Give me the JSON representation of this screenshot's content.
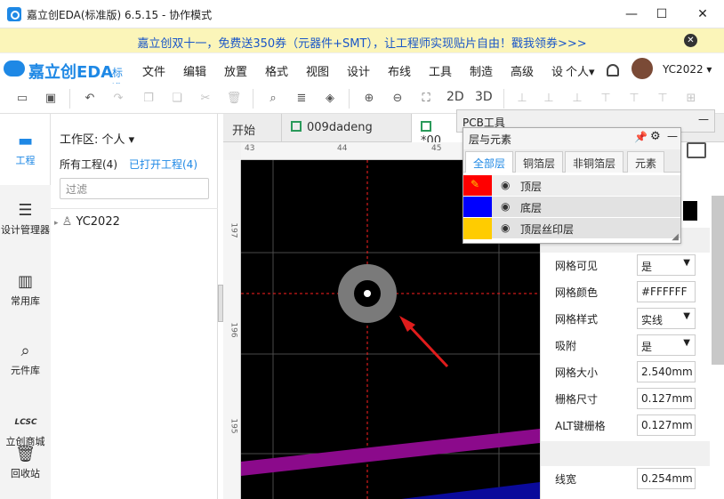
{
  "window": {
    "title": "嘉立创EDA(标准版) 6.5.15 - 协作模式",
    "min_label": "—",
    "max_label": "☐",
    "close_label": "✕"
  },
  "banner": {
    "text": "嘉立创双十一，免费送350券（元器件+SMT），让工程师实现贴片自由！戳我领券>>>",
    "close_label": "✕"
  },
  "logo": {
    "name": "嘉立创EDA",
    "edition": "标准"
  },
  "menu": [
    "文件",
    "编辑",
    "放置",
    "格式",
    "视图",
    "设计",
    "布线",
    "工具",
    "制造",
    "高级",
    "设"
  ],
  "account": {
    "workspace": "个人",
    "user": "YC2022"
  },
  "toolbar": {
    "label_2d": "2D",
    "label_3d": "3D"
  },
  "leftbar": [
    {
      "label": "工程",
      "icon": "folder-icon"
    },
    {
      "label": "设计管理器",
      "icon": "design-manager-icon"
    },
    {
      "label": "常用库",
      "icon": "chip-icon"
    },
    {
      "label": "元件库",
      "icon": "component-search-icon"
    },
    {
      "label": "立创商城",
      "icon": "lcsc-icon"
    },
    {
      "label": "回收站",
      "icon": "trash-icon"
    }
  ],
  "project_panel": {
    "workspace_label": "工作区: 个人 ▾",
    "tab_all": "所有工程(4)",
    "tab_open": "已打开工程(4)",
    "filter_placeholder": "过滤",
    "tree_root": "YC2022"
  },
  "tabs": [
    {
      "label": "开始"
    },
    {
      "label": "009dadeng"
    },
    {
      "label": "*00"
    }
  ],
  "ruler": {
    "top": [
      "43",
      "44",
      "45"
    ],
    "left": [
      "197",
      "196",
      "195"
    ]
  },
  "pcb_tools": {
    "title": "PCB工具",
    "min_label": "—"
  },
  "layers_panel": {
    "title": "层与元素",
    "tabs": [
      "全部层",
      "铜箔层",
      "非铜箔层",
      "元素"
    ],
    "rows": [
      {
        "name": "顶层",
        "color": "#ff0000"
      },
      {
        "name": "底层",
        "color": "#0000ff"
      },
      {
        "name": "顶层丝印层",
        "color": "#ffcc00"
      }
    ]
  },
  "properties": [
    {
      "label": "网格可见",
      "value": "是",
      "dropdown": true
    },
    {
      "label": "网格颜色",
      "value": "#FFFFFF",
      "dropdown": false
    },
    {
      "label": "网格样式",
      "value": "实线",
      "dropdown": true
    },
    {
      "label": "吸附",
      "value": "是",
      "dropdown": true
    },
    {
      "label": "网格大小",
      "value": "2.540mm",
      "dropdown": false
    },
    {
      "label": "栅格尺寸",
      "value": "0.127mm",
      "dropdown": false
    },
    {
      "label": "ALT键栅格",
      "value": "0.127mm",
      "dropdown": false
    },
    {
      "label": "线宽",
      "value": "0.254mm",
      "dropdown": false
    }
  ]
}
